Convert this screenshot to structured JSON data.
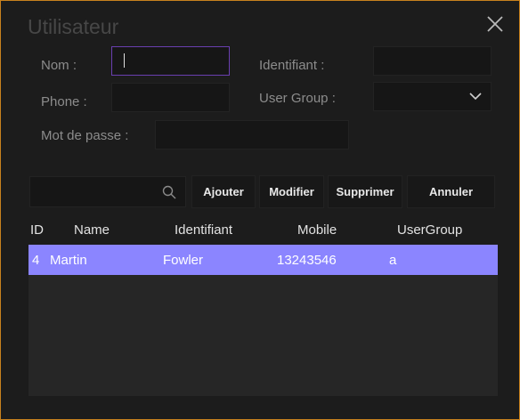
{
  "window": {
    "title": "Utilisateur"
  },
  "form": {
    "nom_label": "Nom :",
    "nom_value": "",
    "identifiant_label": "Identifiant :",
    "identifiant_value": "",
    "phone_label": "Phone :",
    "phone_value": "",
    "usergroup_label": "User Group :",
    "usergroup_value": "",
    "password_label": "Mot de passe :",
    "password_value": ""
  },
  "search": {
    "value": ""
  },
  "toolbar": {
    "add_label": "Ajouter",
    "edit_label": "Modifier",
    "delete_label": "Supprimer",
    "cancel_label": "Annuler"
  },
  "table": {
    "columns": [
      "ID",
      "Name",
      "Identifiant",
      "Mobile",
      "UserGroup"
    ],
    "rows": [
      {
        "id": "4",
        "name": "Martin",
        "identifiant": "Fowler",
        "mobile": "13243546",
        "usergroup": "a"
      }
    ]
  },
  "colors": {
    "border": "#c8821e",
    "selected_row": "#8b85ff",
    "focus_border": "#6a3fb0"
  }
}
